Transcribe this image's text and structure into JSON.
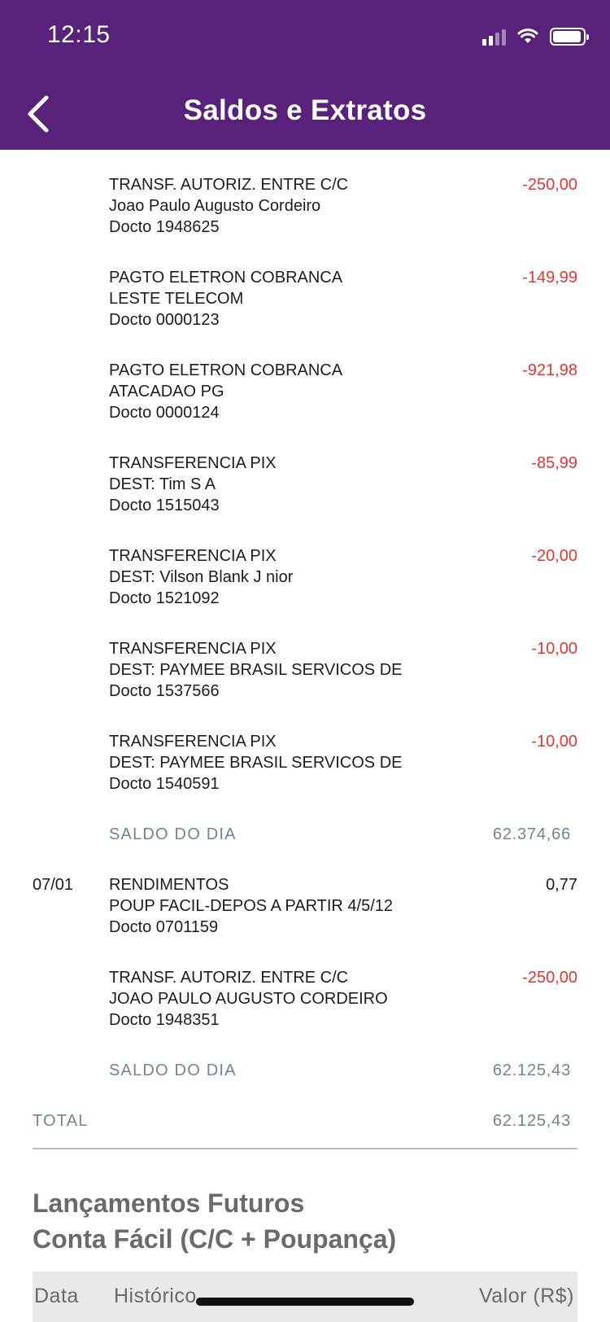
{
  "status_bar": {
    "time": "12:15"
  },
  "header": {
    "title": "Saldos e Extratos"
  },
  "entries": [
    {
      "date": "",
      "line1": "TRANSF. AUTORIZ. ENTRE C/C",
      "line2": "Joao Paulo Augusto Cordeiro",
      "line3": "Docto 1948625",
      "amount": "-250,00"
    },
    {
      "date": "",
      "line1": "PAGTO ELETRON COBRANCA",
      "line2": "LESTE TELECOM",
      "line3": "Docto 0000123",
      "amount": "-149,99"
    },
    {
      "date": "",
      "line1": "PAGTO ELETRON COBRANCA",
      "line2": "ATACADAO PG",
      "line3": "Docto 0000124",
      "amount": "-921,98"
    },
    {
      "date": "",
      "line1": "TRANSFERENCIA PIX",
      "line2": "DEST: Tim S A",
      "line3": "Docto 1515043",
      "amount": "-85,99"
    },
    {
      "date": "",
      "line1": "TRANSFERENCIA PIX",
      "line2": "DEST: Vilson Blank J nior",
      "line3": "Docto 1521092",
      "amount": "-20,00"
    },
    {
      "date": "",
      "line1": "TRANSFERENCIA PIX",
      "line2": "DEST: PAYMEE BRASIL SERVICOS DE",
      "line3": "Docto 1537566",
      "amount": "-10,00"
    },
    {
      "date": "",
      "line1": "TRANSFERENCIA PIX",
      "line2": "DEST: PAYMEE BRASIL SERVICOS DE",
      "line3": "Docto 1540591",
      "amount": "-10,00"
    },
    {
      "date": "07/01",
      "line1": "RENDIMENTOS",
      "line2": "POUP FACIL-DEPOS A PARTIR 4/5/12",
      "line3": "Docto 0701159",
      "amount": "0,77"
    },
    {
      "date": "",
      "line1": "TRANSF. AUTORIZ. ENTRE C/C",
      "line2": "JOAO PAULO AUGUSTO CORDEIRO",
      "line3": "Docto 1948351",
      "amount": "-250,00"
    }
  ],
  "saldos": [
    {
      "label": "SALDO DO DIA",
      "value": "62.374,66"
    },
    {
      "label": "SALDO DO DIA",
      "value": "62.125,43"
    }
  ],
  "total": {
    "label": "TOTAL",
    "value": "62.125,43"
  },
  "future": {
    "title_line1": "Lançamentos Futuros",
    "title_line2": "Conta Fácil (C/C + Poupança)",
    "columns": {
      "date": "Data",
      "history": "Histórico",
      "value": "Valor (R$)"
    }
  },
  "colors": {
    "header": "#58217a",
    "negative": "#e8352e",
    "saldo": "#6f8596"
  }
}
